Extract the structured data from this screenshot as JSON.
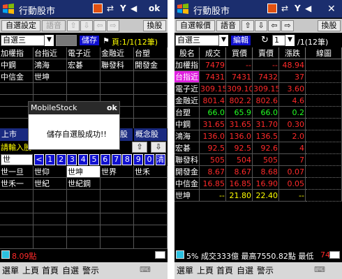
{
  "left": {
    "app_title": "行動股市",
    "toolbar": {
      "self_setting": "自選設定",
      "voice": "語音",
      "save": "儲存",
      "flag": "⚑",
      "page_info": "頁:1/1(12筆)",
      "switch_stock": "換股"
    },
    "list_selector": "自選三",
    "grid": [
      [
        "加權指",
        "台指近",
        "電子近",
        "金融近",
        "台塑"
      ],
      [
        "中鋼",
        "鴻海",
        "宏碁",
        "聯發科",
        "開發金"
      ],
      [
        "中信金",
        "世坤",
        "",
        "",
        ""
      ]
    ],
    "dialog": {
      "title": "MobileStock",
      "ok": "ok",
      "message": "儲存自選股成功!!"
    },
    "bar2": {
      "listed": "上市",
      "share": "股",
      "concept": "概念股"
    },
    "input_prompt": "請輸入股",
    "input_value": "世",
    "keys": [
      "<",
      "1",
      "2",
      "3",
      "4",
      "5",
      "6",
      "7",
      "8",
      "9",
      "0",
      "清"
    ],
    "suggestions": [
      [
        "世一旦",
        "世仰",
        "世坤",
        "世界",
        "世禾"
      ],
      [
        "世禾一",
        "世紀",
        "世紀鋼",
        "",
        ""
      ]
    ],
    "status": "8.09點",
    "menu": [
      "選單",
      "上頁",
      "首頁",
      "自選",
      "警示"
    ]
  },
  "right": {
    "app_title": "行動股市",
    "toolbar": {
      "self_quote": "自選報價",
      "voice": "語音",
      "switch_stock": "換股"
    },
    "list_selector": "自選三",
    "edit": "編輯",
    "page_value": "1",
    "page_total": "/1(12筆)",
    "headers": [
      "股名",
      "成交",
      "買價",
      "賣價",
      "漲跌",
      "線圖"
    ],
    "rows": [
      {
        "name": "加權指",
        "vals": [
          "7479",
          "--",
          "--",
          "48.94"
        ],
        "name_bg": "#000000",
        "color": "#ff2a2a"
      },
      {
        "name": "台指近",
        "vals": [
          "7431",
          "7431",
          "7432",
          "37"
        ],
        "name_bg": "#e020e0",
        "color": "#ff2a2a"
      },
      {
        "name": "電子近",
        "vals": [
          "309.15",
          "309.10",
          "309.15",
          "3.60"
        ],
        "name_bg": "#000000",
        "color": "#ff2a2a"
      },
      {
        "name": "金融近",
        "vals": [
          "801.4",
          "802.2",
          "802.6",
          "4.6"
        ],
        "name_bg": "#000000",
        "color": "#ff2a2a"
      },
      {
        "name": "台塑",
        "vals": [
          "66.0",
          "65.9",
          "66.0",
          "0.2"
        ],
        "name_bg": "#000000",
        "color": "#23ff23"
      },
      {
        "name": "中鋼",
        "vals": [
          "31.65",
          "31.65",
          "31.70",
          "0.30"
        ],
        "name_bg": "#000000",
        "color": "#ff2a2a"
      },
      {
        "name": "鴻海",
        "vals": [
          "136.0",
          "136.0",
          "136.5",
          "2.0"
        ],
        "name_bg": "#000000",
        "color": "#ff2a2a"
      },
      {
        "name": "宏碁",
        "vals": [
          "92.5",
          "92.5",
          "92.6",
          "4"
        ],
        "name_bg": "#000000",
        "color": "#ff2a2a"
      },
      {
        "name": "聯發科",
        "vals": [
          "505",
          "504",
          "505",
          "7"
        ],
        "name_bg": "#000000",
        "color": "#ff2a2a"
      },
      {
        "name": "開發金",
        "vals": [
          "8.67",
          "8.67",
          "8.68",
          "0.07"
        ],
        "name_bg": "#000000",
        "color": "#ff2a2a"
      },
      {
        "name": "中信金",
        "vals": [
          "16.85",
          "16.85",
          "16.90",
          "0.05"
        ],
        "name_bg": "#000000",
        "color": "#ff2a2a"
      },
      {
        "name": "世坤",
        "vals": [
          "--",
          "21.80",
          "22.40",
          "--"
        ],
        "name_bg": "#000000",
        "color": "#ffff00"
      }
    ],
    "status": "5% 成交333億 最高7550.82點 最低",
    "status_tail": "74",
    "menu": [
      "選單",
      "上頁",
      "首頁",
      "自選",
      "警示"
    ]
  }
}
